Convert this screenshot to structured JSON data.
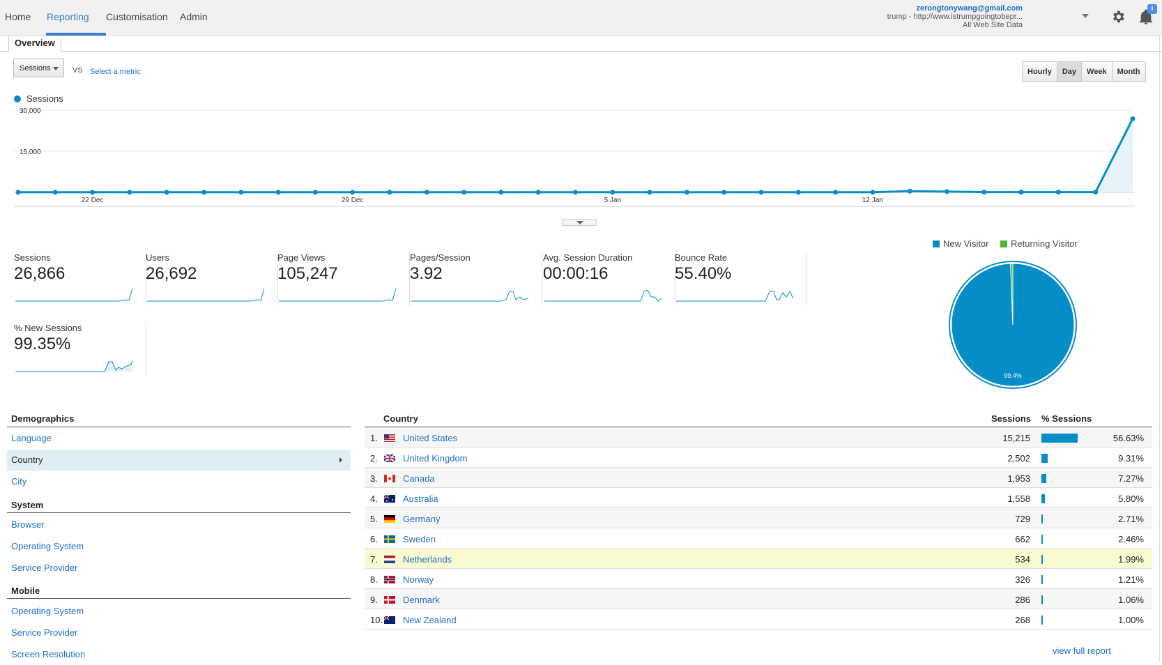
{
  "nav": {
    "home": "Home",
    "reporting": "Reporting",
    "customisation": "Customisation",
    "admin": "Admin"
  },
  "account": {
    "email": "zerongtonywang@gmail.com",
    "property": "trump - http://www.istrumpgoingtobepr...",
    "view": "All Web Site Data",
    "badge": "i"
  },
  "tabs": {
    "overview": "Overview"
  },
  "controls": {
    "metric": "Sessions",
    "vs": "VS",
    "select_metric": "Select a metric",
    "time_buttons": [
      "Hourly",
      "Day",
      "Week",
      "Month"
    ],
    "selected_time": "Day"
  },
  "chart_data": {
    "type": "area",
    "series_name": "Sessions",
    "y_ticks": [
      "30,000",
      "15,000"
    ],
    "ylim": [
      0,
      30000
    ],
    "x_tick_labels": [
      "22 Dec",
      "29 Dec",
      "5 Jan",
      "12 Jan"
    ],
    "values": [
      50,
      50,
      50,
      50,
      50,
      50,
      50,
      50,
      50,
      50,
      50,
      50,
      50,
      50,
      50,
      50,
      50,
      50,
      50,
      50,
      50,
      50,
      50,
      50,
      450,
      300,
      100,
      100,
      100,
      100,
      26866
    ],
    "color": "#058dc7"
  },
  "summary": {
    "sessions": {
      "label": "Sessions",
      "value": "26,866"
    },
    "users": {
      "label": "Users",
      "value": "26,692"
    },
    "page_views": {
      "label": "Page Views",
      "value": "105,247"
    },
    "pages_session": {
      "label": "Pages/Session",
      "value": "3.92"
    },
    "avg_duration": {
      "label": "Avg. Session Duration",
      "value": "00:00:16"
    },
    "bounce_rate": {
      "label": "Bounce Rate",
      "value": "55.40%"
    },
    "new_sessions": {
      "label": "% New Sessions",
      "value": "99.35%"
    }
  },
  "pie": {
    "new_label": "New Visitor",
    "returning_label": "Returning Visitor",
    "new_pct_label": "99.4%",
    "new_fraction": 0.994,
    "new_color": "#058dc7",
    "returning_color": "#50b432"
  },
  "left_nav": {
    "demographics": "Demographics",
    "language": "Language",
    "country": "Country",
    "city": "City",
    "system": "System",
    "browser": "Browser",
    "os": "Operating System",
    "service_provider": "Service Provider",
    "mobile": "Mobile",
    "mobile_os": "Operating System",
    "mobile_sp": "Service Provider",
    "screen_resolution": "Screen Resolution"
  },
  "table": {
    "col_country": "Country",
    "col_sessions": "Sessions",
    "col_pct": "% Sessions",
    "rows": [
      {
        "rank": "1.",
        "country": "United States",
        "sessions": "15,215",
        "pct": "56.63%",
        "frac": 0.5663,
        "flag": "us"
      },
      {
        "rank": "2.",
        "country": "United Kingdom",
        "sessions": "2,502",
        "pct": "9.31%",
        "frac": 0.0931,
        "flag": "gb"
      },
      {
        "rank": "3.",
        "country": "Canada",
        "sessions": "1,953",
        "pct": "7.27%",
        "frac": 0.0727,
        "flag": "ca"
      },
      {
        "rank": "4.",
        "country": "Australia",
        "sessions": "1,558",
        "pct": "5.80%",
        "frac": 0.058,
        "flag": "au"
      },
      {
        "rank": "5.",
        "country": "Germany",
        "sessions": "729",
        "pct": "2.71%",
        "frac": 0.0271,
        "flag": "de"
      },
      {
        "rank": "6.",
        "country": "Sweden",
        "sessions": "662",
        "pct": "2.46%",
        "frac": 0.0246,
        "flag": "se"
      },
      {
        "rank": "7.",
        "country": "Netherlands",
        "sessions": "534",
        "pct": "1.99%",
        "frac": 0.0199,
        "flag": "nl"
      },
      {
        "rank": "8.",
        "country": "Norway",
        "sessions": "326",
        "pct": "1.21%",
        "frac": 0.0121,
        "flag": "no"
      },
      {
        "rank": "9.",
        "country": "Denmark",
        "sessions": "286",
        "pct": "1.06%",
        "frac": 0.0106,
        "flag": "dk"
      },
      {
        "rank": "10.",
        "country": "New Zealand",
        "sessions": "268",
        "pct": "1.00%",
        "frac": 0.01,
        "flag": "nz"
      }
    ],
    "view_full": "view full report"
  }
}
